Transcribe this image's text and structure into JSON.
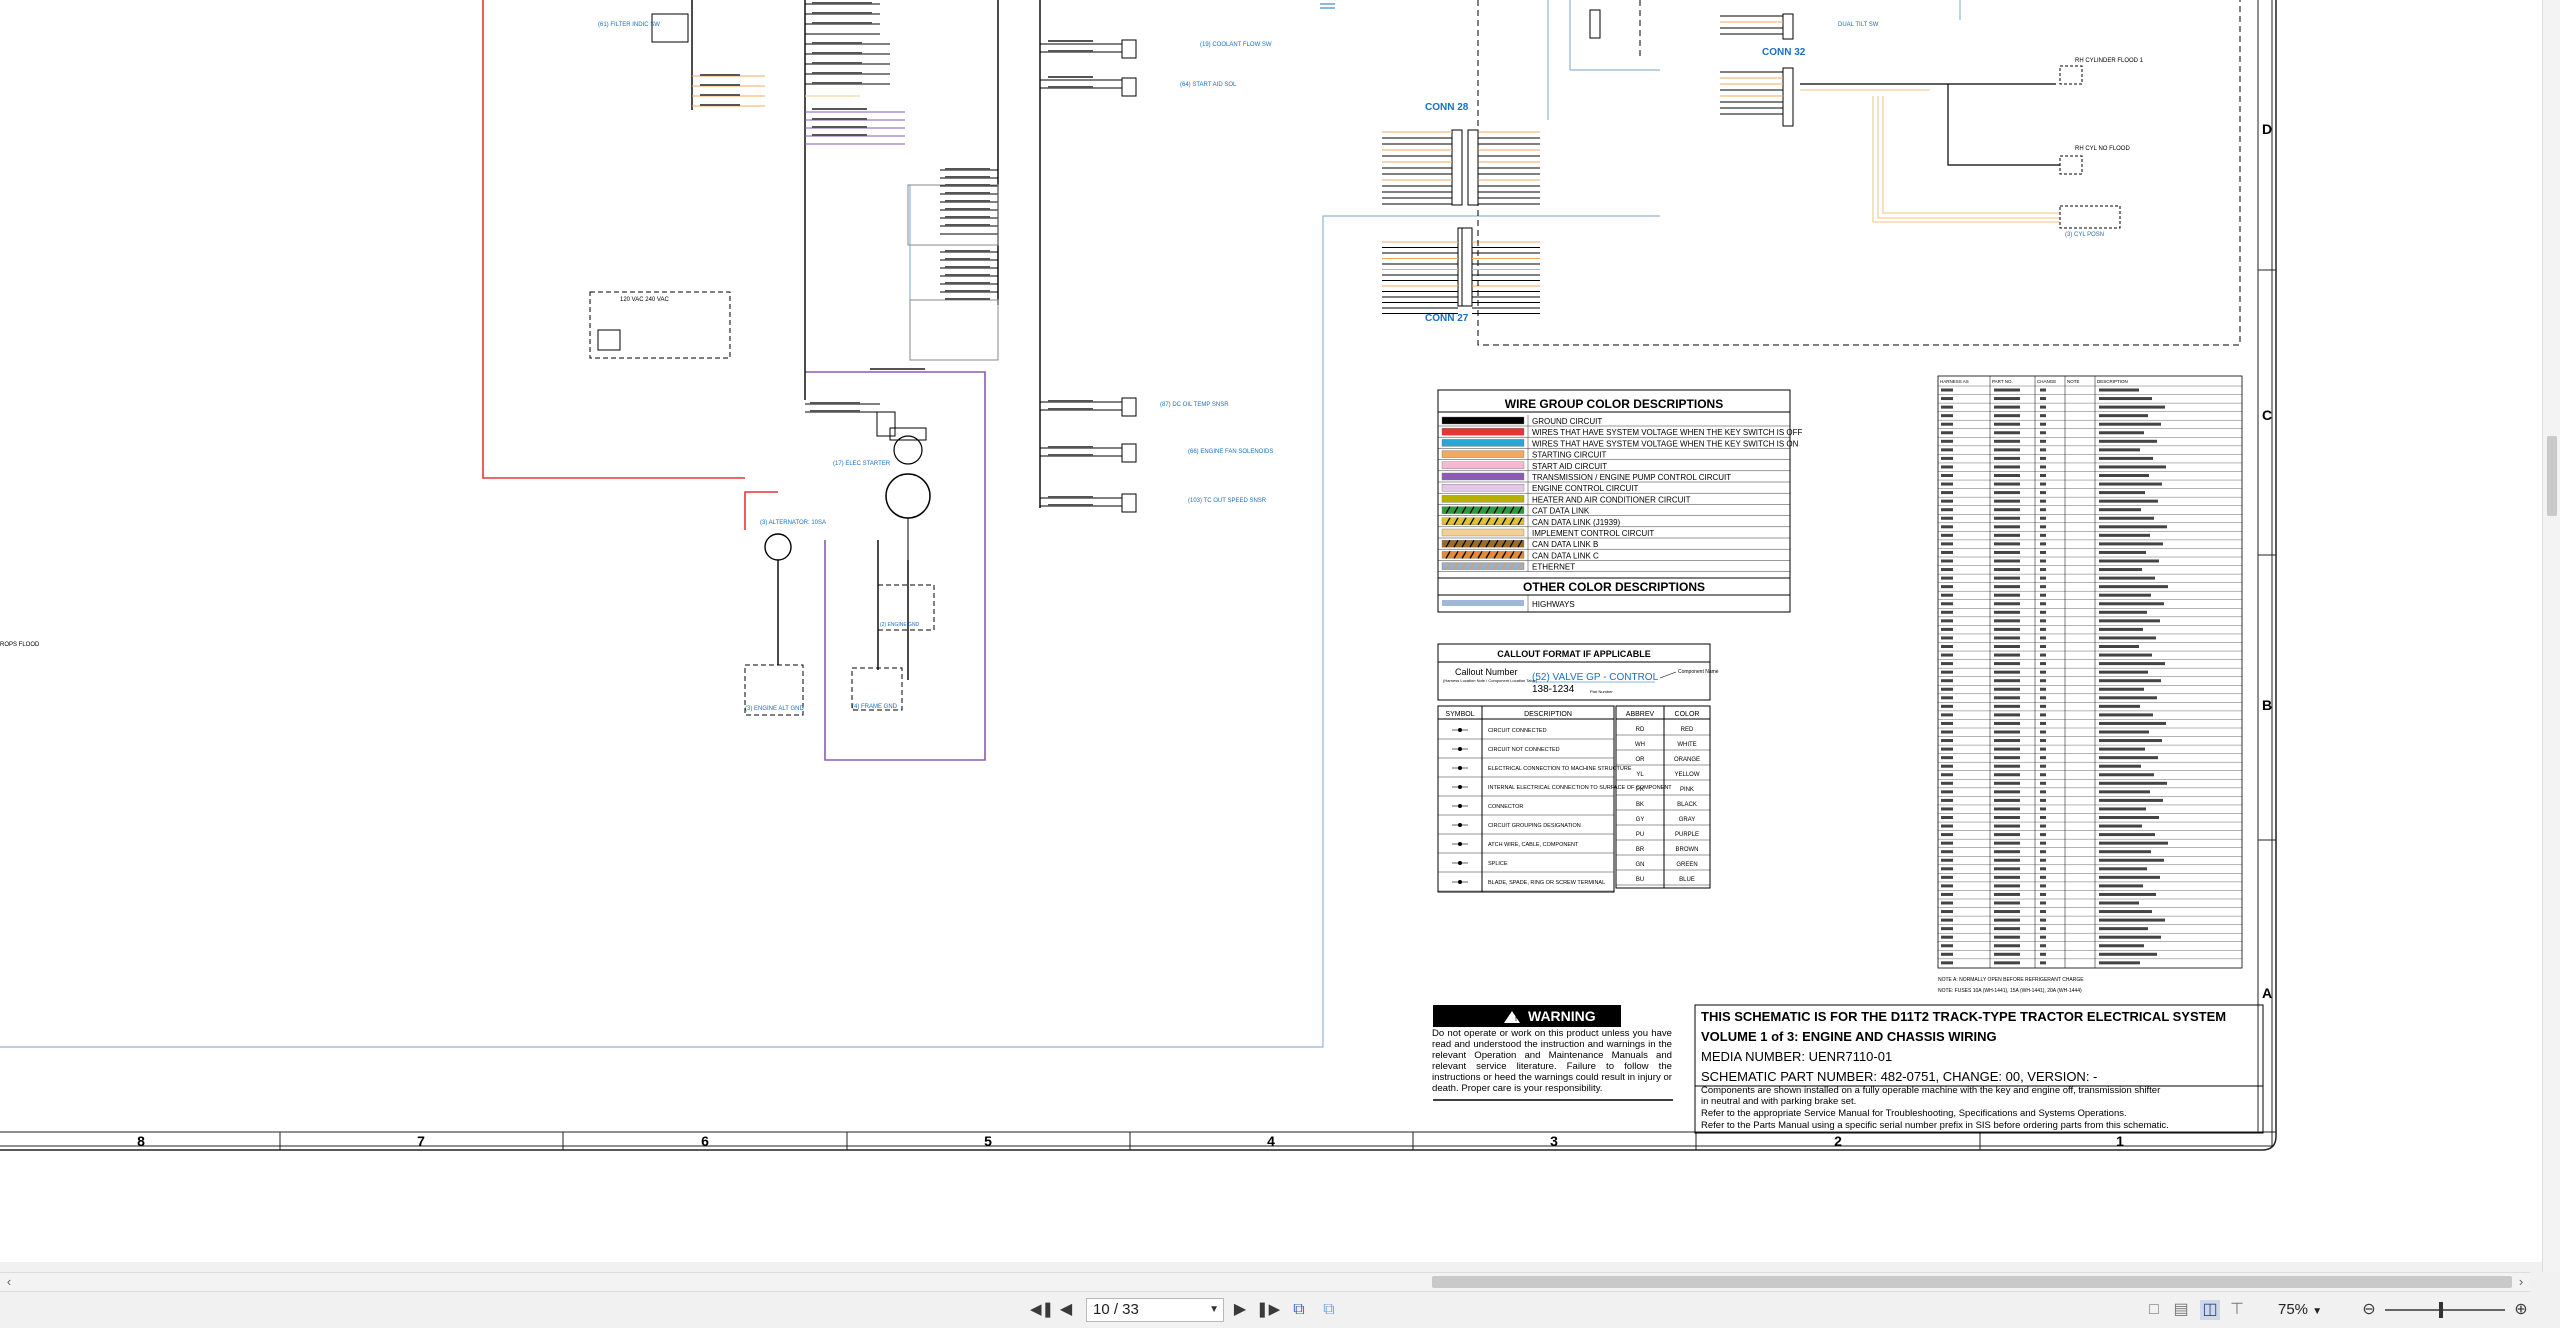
{
  "viewer": {
    "page_field": "10 / 33",
    "zoom": "75%",
    "icons": [
      "first-page-icon",
      "prev-page-icon",
      "next-page-icon",
      "last-page-icon",
      "dual-page-icon",
      "fit-page-icon",
      "single-page-view-icon",
      "continuous-view-icon",
      "two-page-view-icon",
      "facing-view-icon",
      "zoom-out-icon",
      "zoom-in-icon"
    ]
  },
  "grid": {
    "columns": [
      "8",
      "7",
      "6",
      "5",
      "4",
      "3",
      "2",
      "1"
    ],
    "rows": [
      "D",
      "C",
      "B",
      "A"
    ]
  },
  "connectors": {
    "conn28": "CONN 28",
    "conn27": "CONN 27",
    "conn32": "CONN 32"
  },
  "callouts": {
    "coolant_flow": "(19) COOLANT FLOW SW",
    "start_aid": "(64) START AID SOL",
    "eng_oil_temp": "(87) DC OIL TEMP SNSR",
    "fan_solenoid": "(66) ENGINE FAN SOLENOIDS",
    "trans_out_speed": "(103) TC OUT SPEED SNSR",
    "alternator": "(3) ALTERNATOR: 10SA",
    "starter": "(17) ELEC STARTER",
    "ground_bolt": "(2) ENGINE GND",
    "chassis_ground": "(4) FRAME GND",
    "alt_ground": "(3) ENGINE ALT GND",
    "flow_filter": "(61) FILTER INDIC SW",
    "cylinder_flood": "RH CYLINDER FLOOD 1",
    "cyl_no_flood": "RH CYL NO FLOOD",
    "rops_flood": "ROPS FLOOD",
    "cyl_position": "(3) CYL POSN",
    "dual_tilt": "DUAL TILT SW",
    "heater_block": "120 VAC   240 VAC"
  },
  "legend": {
    "title": "WIRE GROUP COLOR DESCRIPTIONS",
    "rows": [
      {
        "label": "GROUND CIRCUIT",
        "colors": [
          "#000000"
        ]
      },
      {
        "label": "WIRES THAT HAVE SYSTEM VOLTAGE WHEN THE KEY SWITCH IS OFF",
        "colors": [
          "#e53535"
        ]
      },
      {
        "label": "WIRES THAT HAVE SYSTEM VOLTAGE WHEN THE KEY SWITCH IS ON",
        "colors": [
          "#27a6d8"
        ]
      },
      {
        "label": "STARTING CIRCUIT",
        "colors": [
          "#f4a85e"
        ]
      },
      {
        "label": "START AID CIRCUIT",
        "colors": [
          "#f7b8d2"
        ]
      },
      {
        "label": "TRANSMISSION / ENGINE PUMP CONTROL CIRCUIT",
        "colors": [
          "#8a5ab5"
        ]
      },
      {
        "label": "ENGINE CONTROL CIRCUIT",
        "colors": [
          "#e4c8e8"
        ]
      },
      {
        "label": "HEATER AND AIR CONDITIONER CIRCUIT",
        "colors": [
          "#b8b000"
        ]
      },
      {
        "label": "CAT DATA LINK",
        "colors": [
          "#2d9a3c",
          "#000000"
        ]
      },
      {
        "label": "CAN DATA LINK (J1939)",
        "colors": [
          "#e2c034",
          "#000000"
        ]
      },
      {
        "label": "IMPLEMENT CONTROL CIRCUIT",
        "colors": [
          "#f3cf93"
        ]
      },
      {
        "label": "CAN DATA LINK B",
        "colors": [
          "#9a6a2b",
          "#000000"
        ]
      },
      {
        "label": "CAN DATA LINK C",
        "colors": [
          "#e08a3c",
          "#000000"
        ]
      },
      {
        "label": "ETHERNET",
        "colors": [
          "#9bb0c8",
          "#d8a058"
        ]
      }
    ],
    "other_title": "OTHER COLOR DESCRIPTIONS",
    "other_rows": [
      {
        "label": "HIGHWAYS",
        "colors": [
          "#9fb7d8"
        ]
      }
    ]
  },
  "callout_format": {
    "title": "CALLOUT FORMAT IF APPLICABLE",
    "callout_number": "Callout Number",
    "callout_sub": "(Harness Location Note / Component Location Table)",
    "component_name": "(52) VALVE GP - CONTROL",
    "part_number": "138-1234",
    "component_label": "Component Name",
    "part_label": "Part Number"
  },
  "symbols": {
    "header_symbol": "SYMBOL",
    "header_desc": "DESCRIPTION",
    "rows": [
      "CIRCUIT CONNECTED",
      "CIRCUIT NOT CONNECTED",
      "ELECTRICAL CONNECTION TO MACHINE STRUCTURE",
      "INTERNAL ELECTRICAL CONNECTION TO SURFACE OF COMPONENT",
      "CONNECTOR",
      "CIRCUIT GROUPING DESIGNATION",
      "ATCH WIRE, CABLE, COMPONENT",
      "SPLICE",
      "BLADE, SPADE, RING OR SCREW TERMINAL"
    ]
  },
  "abbrev": {
    "header_abbrev": "ABBREV",
    "header_color": "COLOR",
    "rows": [
      [
        "RD",
        "RED"
      ],
      [
        "WH",
        "WHITE"
      ],
      [
        "OR",
        "ORANGE"
      ],
      [
        "YL",
        "YELLOW"
      ],
      [
        "PK",
        "PINK"
      ],
      [
        "BK",
        "BLACK"
      ],
      [
        "GY",
        "GRAY"
      ],
      [
        "PU",
        "PURPLE"
      ],
      [
        "BR",
        "BROWN"
      ],
      [
        "GN",
        "GREEN"
      ],
      [
        "BU",
        "BLUE"
      ]
    ]
  },
  "harness": {
    "headers": [
      "HARNESS AS",
      "PART NO.",
      "CHANGE",
      "NOTE",
      "DESCRIPTION"
    ],
    "note_a": "NOTE A: NORMALLY OPEN BEFORE REFRIGERANT CHARGE",
    "note_fuses": "NOTE: FUSES  10A (WH-1441), 15A (WH-1441), 20A (WH-1444)"
  },
  "warning": {
    "title": "WARNING",
    "body": "Do not operate or work on this product unless you have read and understood the instruction and warnings in the relevant Operation and Maintenance Manuals and relevant service literature. Failure to follow the instructions or heed the warnings could result in injury or death. Proper care is your responsibility."
  },
  "title_block": {
    "line1": "THIS SCHEMATIC IS FOR THE D11T2 TRACK-TYPE TRACTOR ELECTRICAL SYSTEM",
    "line2": "VOLUME 1 of 3: ENGINE AND CHASSIS WIRING",
    "media": "MEDIA NUMBER: UENR7110-01",
    "schematic": "SCHEMATIC PART NUMBER: 482-0751, CHANGE: 00, VERSION: -",
    "note1": "Components are shown installed on a fully operable machine with the key and engine off, transmission shifter",
    "note2": "in neutral and with parking brake set.",
    "note3": "Refer to the appropriate Service Manual for Troubleshooting, Specifications and Systems Operations.",
    "note4": "Refer to the Parts Manual using a specific serial number prefix in SIS before ordering parts from this schematic."
  }
}
